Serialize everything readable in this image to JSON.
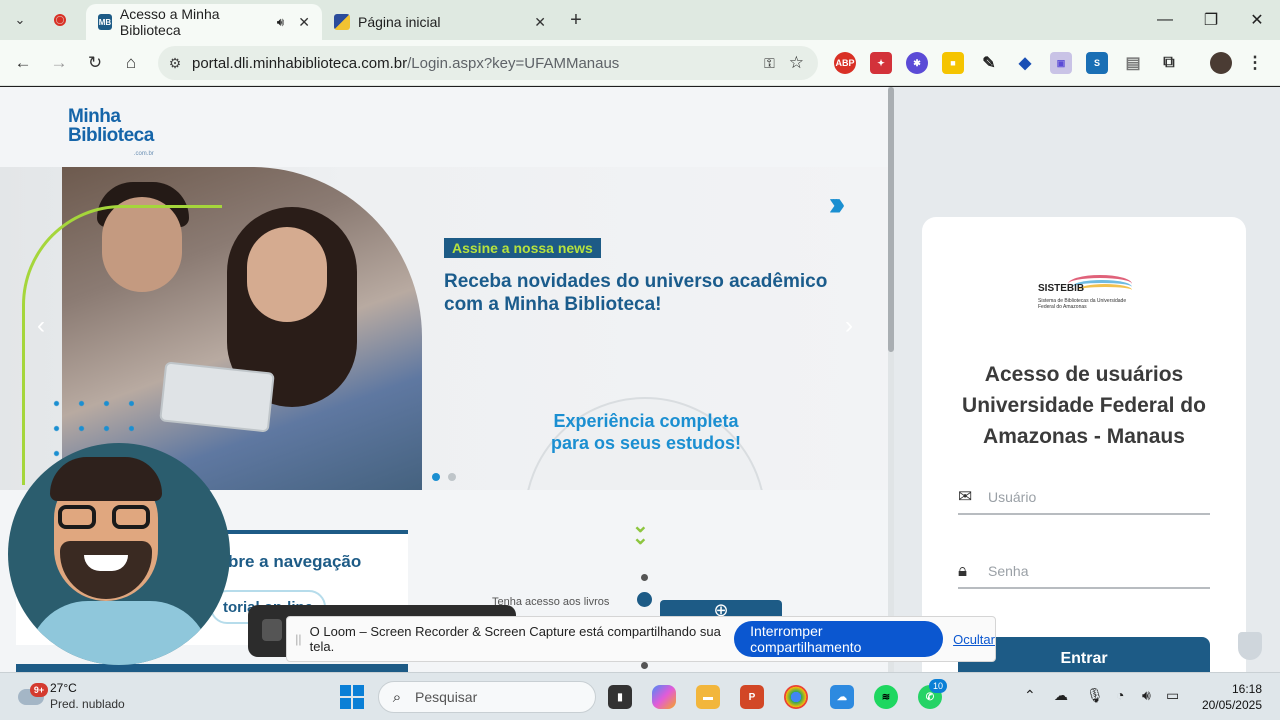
{
  "browser": {
    "tabs": [
      {
        "favicon": "MB",
        "title": "Acesso a Minha Biblioteca",
        "active": true,
        "audio": true
      },
      {
        "favicon": "flag",
        "title": "Página inicial",
        "active": false
      }
    ],
    "url_host": "portal.dli.minhabiblioteca.com.br",
    "url_path": "/Login.aspx?key=UFAMManaus",
    "extensions": [
      "abp",
      "red-ext",
      "purple-ext",
      "yellow-ext",
      "eyedropper",
      "mortarboard",
      "purple-square",
      "blue-s",
      "doc",
      "puzzle"
    ],
    "abp_label": "ABP"
  },
  "site": {
    "logo_line1": "Minha",
    "logo_line2": "Biblioteca",
    "logo_suffix": ".com.br"
  },
  "banner": {
    "tag": "Assine a nossa news",
    "headline": "Receba novidades do universo acadêmico com a Minha Biblioteca!",
    "experience": "Experiência completa para os seus estudos!",
    "slides": 2,
    "active_slide": 1
  },
  "below": {
    "nav_title": "bre a navegação",
    "tutorial": "torial on-line",
    "biblio_text": "Tenha acesso aos livros"
  },
  "login": {
    "brand": "SISTEBIB",
    "brand_sub": "Sistema de Bibliotecas da Universidade Federal do Amazonas",
    "title": "Acesso de usuários Universidade Federal do Amazonas - Manaus",
    "user_placeholder": "Usuário",
    "password_placeholder": "Senha",
    "submit": "Entrar"
  },
  "loom": {
    "message": "O Loom – Screen Recorder & Screen Capture está compartilhando sua tela.",
    "stop_label": "Interromper compartilhamento",
    "hide_label": "Ocultar"
  },
  "taskbar": {
    "weather_badge": "9+",
    "temperature": "27°C",
    "condition": "Pred. nublado",
    "search_placeholder": "Pesquisar",
    "whatsapp_badge": "10",
    "time": "16:18",
    "date": "20/05/2025"
  },
  "colors": {
    "brand_blue": "#1d5b86",
    "accent_green": "#b6e23e",
    "stop_button": "#0b57d0"
  }
}
